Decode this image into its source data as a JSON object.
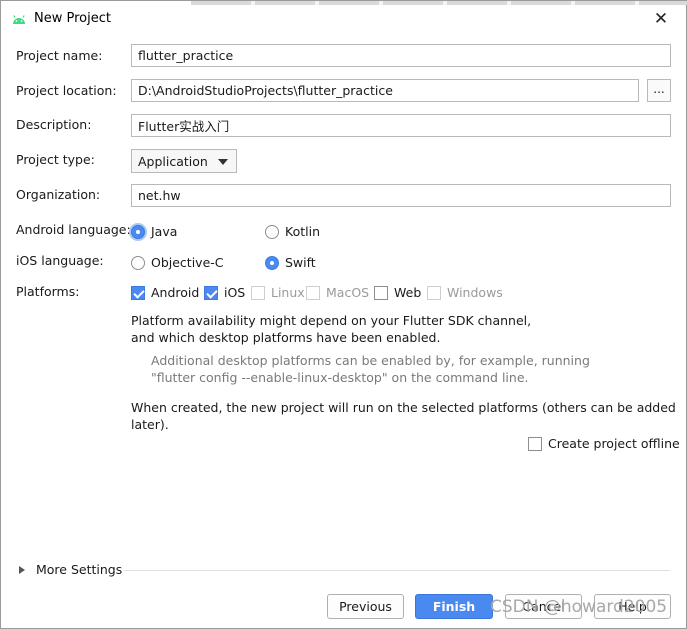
{
  "window": {
    "title": "New Project",
    "close_glyph": "✕"
  },
  "form": {
    "project_name": {
      "label": "Project name:",
      "value": "flutter_practice"
    },
    "project_location": {
      "label": "Project location:",
      "value": "D:\\AndroidStudioProjects\\flutter_practice",
      "browse_label": "..."
    },
    "description": {
      "label": "Description:",
      "value": "Flutter实战入门"
    },
    "project_type": {
      "label": "Project type:",
      "value": "Application"
    },
    "organization": {
      "label": "Organization:",
      "value": "net.hw"
    },
    "android_language": {
      "label": "Android language:",
      "options": [
        {
          "label": "Java",
          "selected": true
        },
        {
          "label": "Kotlin",
          "selected": false
        }
      ]
    },
    "ios_language": {
      "label": "iOS language:",
      "options": [
        {
          "label": "Objective-C",
          "selected": false
        },
        {
          "label": "Swift",
          "selected": true
        }
      ]
    },
    "platforms": {
      "label": "Platforms:",
      "items": [
        {
          "label": "Android",
          "checked": true,
          "enabled": true
        },
        {
          "label": "iOS",
          "checked": true,
          "enabled": true
        },
        {
          "label": "Linux",
          "checked": false,
          "enabled": false
        },
        {
          "label": "MacOS",
          "checked": false,
          "enabled": false
        },
        {
          "label": "Web",
          "checked": false,
          "enabled": true
        },
        {
          "label": "Windows",
          "checked": false,
          "enabled": false
        }
      ]
    },
    "info": {
      "line1": "Platform availability might depend on your Flutter SDK channel,",
      "line2": "and which desktop platforms have been enabled.",
      "hint1": "Additional desktop platforms can be enabled by, for example, running",
      "hint2": "\"flutter config --enable-linux-desktop\" on the command line.",
      "created": "When created, the new project will run on the selected platforms (others can be added later)."
    },
    "offline": {
      "label": "Create project offline",
      "checked": false
    }
  },
  "more_settings": {
    "label": "More Settings"
  },
  "buttons": {
    "previous": "Previous",
    "finish": "Finish",
    "cancel": "Cancel",
    "help": "Help"
  },
  "watermark": "CSDN @howard2005",
  "colors": {
    "accent": "#4a89f0",
    "disabled_text": "#9a9a9a",
    "hint_text": "#7a7a7a"
  }
}
